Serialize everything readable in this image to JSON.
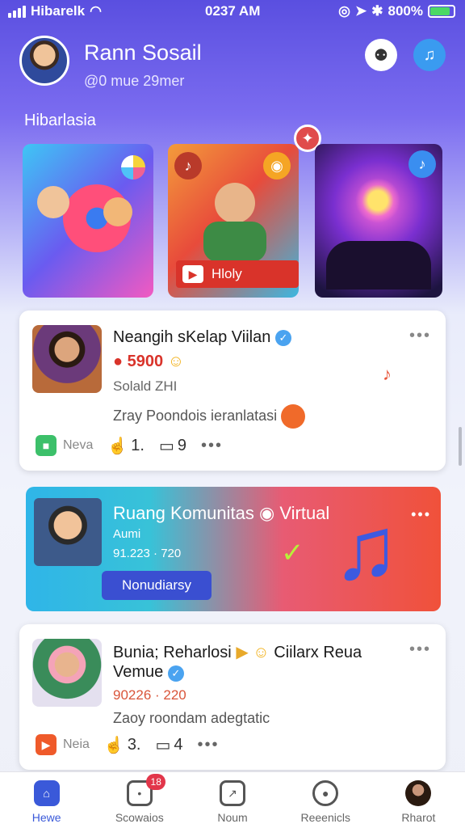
{
  "status_bar": {
    "carrier": "Hibarelk",
    "time": "0237 AM",
    "battery": "800%"
  },
  "header": {
    "user_name": "Rann Sosail",
    "user_sub": "@0 mue 29mer"
  },
  "section_title": "Hibarlasia",
  "carousel": {
    "tile2_badge": "Hloly"
  },
  "post1": {
    "title": "Neangih sKelap Viilan",
    "price": "5900",
    "meta": "Solald ZHI",
    "desc": "Zray Poondois ieranlatasi",
    "tag": "Neva",
    "likes": "1.",
    "comments": "9"
  },
  "community": {
    "title": "Ruang Komunitas",
    "title_suffix": "Virtual",
    "sub": "Aumi",
    "meta": "91.223 · 720",
    "button": "Nonudiarsy"
  },
  "post2": {
    "title": "Bunia; Reharlosi",
    "title_suffix": "Ciilarx Reua",
    "title_line2": "Vemue",
    "meta": "90226 · 220",
    "desc": "Zaoy roondam adegtatic",
    "tag": "Neia",
    "likes": "3.",
    "comments": "4"
  },
  "tabbar": [
    {
      "label": "Hewe",
      "icon": "home-icon"
    },
    {
      "label": "Scowaios",
      "icon": "chat-icon",
      "badge": "18"
    },
    {
      "label": "Noum",
      "icon": "compass-icon"
    },
    {
      "label": "Reeenicls",
      "icon": "user-icon"
    },
    {
      "label": "Rharot",
      "icon": "profile-avatar"
    }
  ]
}
